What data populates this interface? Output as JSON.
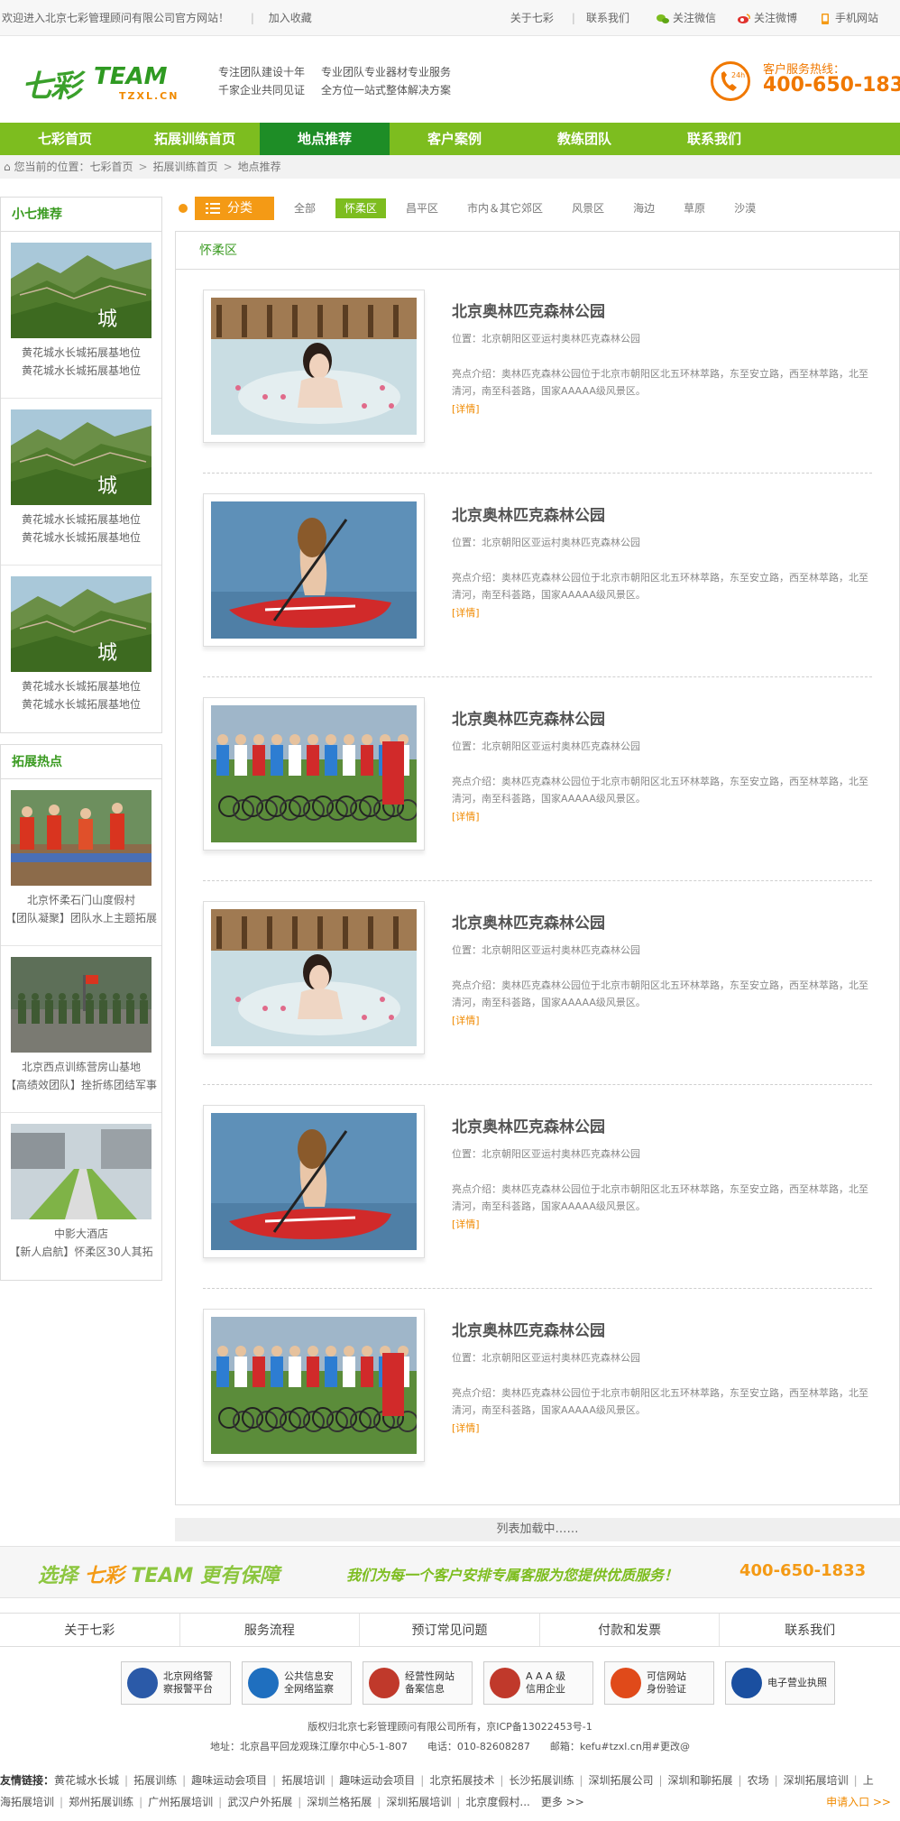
{
  "topbar": {
    "welcome": "欢迎进入北京七彩管理顾问有限公司官方网站！",
    "bookmark": "加入收藏",
    "about": "关于七彩",
    "contact": "联系我们",
    "wechat": "关注微信",
    "weibo": "关注微博",
    "mobile": "手机网站"
  },
  "header": {
    "logo_cn": "七彩",
    "logo_en": "TEAM",
    "logo_sub": "TZXL.CN",
    "slogan1a": "专注团队建设十年",
    "slogan1b": "专业团队专业器材专业服务",
    "slogan2a": "千家企业共同见证",
    "slogan2b": "全方位一站式整体解决方案",
    "hotline_icon_text": "24h",
    "hotline_label": "客户服务热线：",
    "hotline_number": "400-650-1833"
  },
  "nav": [
    "七彩首页",
    "拓展训练首页",
    "地点推荐",
    "客户案例",
    "教练团队",
    "联系我们"
  ],
  "breadcrumb": {
    "prefix": "您当前的位置：",
    "items": [
      "七彩首页",
      "拓展训练首页",
      "地点推荐"
    ]
  },
  "sidebar": {
    "recommend_title": "小七推荐",
    "recommend": [
      {
        "line1": "黄花城水长城拓展基地位",
        "line2": "黄花城水长城拓展基地位"
      },
      {
        "line1": "黄花城水长城拓展基地位",
        "line2": "黄花城水长城拓展基地位"
      },
      {
        "line1": "黄花城水长城拓展基地位",
        "line2": "黄花城水长城拓展基地位"
      }
    ],
    "hot_title": "拓展热点",
    "hot": [
      {
        "line1": "北京怀柔石门山度假村",
        "line2": "【团队凝聚】团队水上主题拓展"
      },
      {
        "line1": "北京西点训练营房山基地",
        "line2": "【高绩效团队】挫折练团结军事"
      },
      {
        "line1": "中影大酒店",
        "line2": "【新人启航】怀柔区30人其拓"
      }
    ]
  },
  "filter": {
    "category": "分类",
    "options": [
      "全部",
      "怀柔区",
      "昌平区",
      "市内＆其它郊区",
      "风景区",
      "海边",
      "草原",
      "沙漠"
    ],
    "active": "怀柔区"
  },
  "list": {
    "heading": "怀柔区",
    "items": [
      {
        "title": "北京奥林匹克森林公园",
        "location": "位置：北京朝阳区亚运村奥林匹克森林公园",
        "desc": "亮点介绍：奥林匹克森林公园位于北京市朝阳区北五环林萃路，东至安立路，西至林萃路，北至清河，南至科荟路，国家AAAAA级风景区。",
        "more": "[详情]",
        "pic": "pool"
      },
      {
        "title": "北京奥林匹克森林公园",
        "location": "位置：北京朝阳区亚运村奥林匹克森林公园",
        "desc": "亮点介绍：奥林匹克森林公园位于北京市朝阳区北五环林萃路，东至安立路，西至林萃路，北至清河，南至科荟路，国家AAAAA级风景区。",
        "more": "[详情]",
        "pic": "kayak"
      },
      {
        "title": "北京奥林匹克森林公园",
        "location": "位置：北京朝阳区亚运村奥林匹克森林公园",
        "desc": "亮点介绍：奥林匹克森林公园位于北京市朝阳区北五环林萃路，东至安立路，西至林萃路，北至清河，南至科荟路，国家AAAAA级风景区。",
        "more": "[详情]",
        "pic": "bikes"
      },
      {
        "title": "北京奥林匹克森林公园",
        "location": "位置：北京朝阳区亚运村奥林匹克森林公园",
        "desc": "亮点介绍：奥林匹克森林公园位于北京市朝阳区北五环林萃路，东至安立路，西至林萃路，北至清河，南至科荟路，国家AAAAA级风景区。",
        "more": "[详情]",
        "pic": "pool"
      },
      {
        "title": "北京奥林匹克森林公园",
        "location": "位置：北京朝阳区亚运村奥林匹克森林公园",
        "desc": "亮点介绍：奥林匹克森林公园位于北京市朝阳区北五环林萃路，东至安立路，西至林萃路，北至清河，南至科荟路，国家AAAAA级风景区。",
        "more": "[详情]",
        "pic": "kayak"
      },
      {
        "title": "北京奥林匹克森林公园",
        "location": "位置：北京朝阳区亚运村奥林匹克森林公园",
        "desc": "亮点介绍：奥林匹克森林公园位于北京市朝阳区北五环林萃路，东至安立路，西至林萃路，北至清河，南至科荟路，国家AAAAA级风景区。",
        "more": "[详情]",
        "pic": "bikes"
      }
    ],
    "loading": "列表加载中……"
  },
  "banner": {
    "part1": "选择",
    "part2": "七彩",
    "part3": "TEAM 更有保障",
    "service": "我们为每一个客户安排专属客服为您提供优质服务！",
    "phone": "400-650-1833"
  },
  "footer_nav": [
    "关于七彩",
    "服务流程",
    "预订常见问题",
    "付款和发票",
    "联系我们"
  ],
  "badges": [
    {
      "l1": "北京网络警",
      "l2": "察报警平台",
      "color": "#2b5aa8"
    },
    {
      "l1": "公共信息安",
      "l2": "全网络监察",
      "color": "#1f6fbf"
    },
    {
      "l1": "经营性网站",
      "l2": "备案信息",
      "color": "#c0392b"
    },
    {
      "l1": "A A A 级",
      "l2": "信用企业",
      "color": "#c0392b"
    },
    {
      "l1": "可信网站",
      "l2": "身份验证",
      "color": "#e04a1a"
    },
    {
      "l1": "电子营业执照",
      "l2": "",
      "color": "#1a4fa0"
    }
  ],
  "copyright": "版权归北京七彩管理顾问有限公司所有，京ICP备13022453号-1",
  "address": "地址：北京昌平回龙观珠江摩尔中心5-1-807　　电话：010-82608287　　邮箱：kefu#tzxl.cn用#更改@",
  "friend_links": {
    "label": "友情链接：",
    "row1": [
      "黄花城水长城",
      "拓展训练",
      "趣味运动会项目",
      "拓展培训",
      "趣味运动会项目",
      "北京拓展技术",
      "长沙拓展训练",
      "深圳拓展公司",
      "深圳和聊拓展",
      "农场",
      "深圳拓展培训",
      "上"
    ],
    "row2": [
      "海拓展培训",
      "郑州拓展训练",
      "广州拓展培训",
      "武汉户外拓展",
      "深圳兰格拓展",
      "深圳拓展培训",
      "北京度假村..."
    ],
    "more": "更多 >>",
    "apply": "申请入口 >>"
  }
}
